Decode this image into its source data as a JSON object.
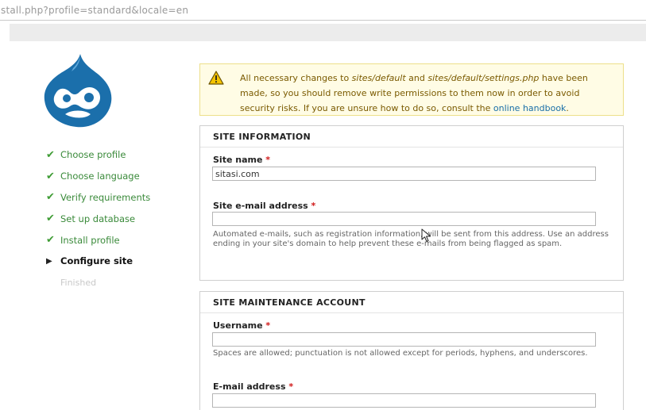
{
  "browser": {
    "url": "stall.php?profile=standard&locale=en"
  },
  "sidebar": {
    "steps": [
      {
        "label": "Choose profile",
        "state": "done"
      },
      {
        "label": "Choose language",
        "state": "done"
      },
      {
        "label": "Verify requirements",
        "state": "done"
      },
      {
        "label": "Set up database",
        "state": "done"
      },
      {
        "label": "Install profile",
        "state": "done"
      },
      {
        "label": "Configure site",
        "state": "active"
      },
      {
        "label": "Finished",
        "state": "pending"
      }
    ]
  },
  "warning": {
    "icon": "warning-triangle-icon",
    "text_1": "All necessary changes to ",
    "path_1": "sites/default",
    "text_2": " and ",
    "path_2": "sites/default/settings.php",
    "text_3": " have been made, so you should remove write permissions to them now in order to avoid security risks. If you are unsure how to do so, consult the ",
    "link": "online handbook",
    "text_4": "."
  },
  "site_information": {
    "legend": "SITE INFORMATION",
    "site_name_label": "Site name",
    "site_name_value": "sitasi.com",
    "site_email_label": "Site e-mail address",
    "site_email_value": "",
    "site_email_desc": "Automated e-mails, such as registration information, will be sent from this address. Use an address ending in your site's domain to help prevent these e-mails from being flagged as spam."
  },
  "maintenance_account": {
    "legend": "SITE MAINTENANCE ACCOUNT",
    "username_label": "Username",
    "username_value": "",
    "username_desc": "Spaces are allowed; punctuation is not allowed except for periods, hyphens, and underscores.",
    "email_label": "E-mail address",
    "email_value": ""
  },
  "required_marker": "*",
  "colors": {
    "done_step": "#3a8a3a",
    "warning_bg": "#fffce5",
    "link": "#1a6fa8",
    "required": "#d01818"
  }
}
